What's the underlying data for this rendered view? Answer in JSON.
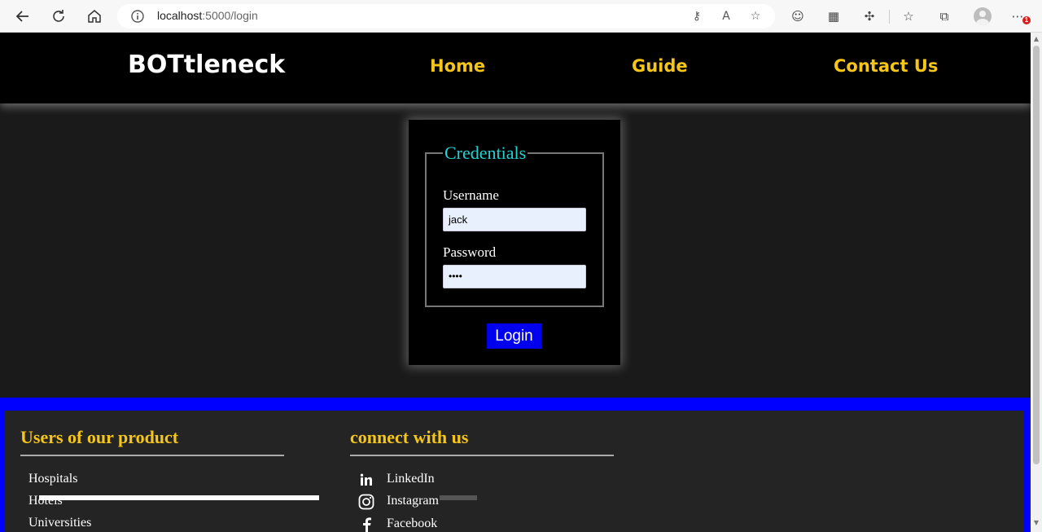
{
  "browser": {
    "url_host": "localhost",
    "url_path": ":5000/login",
    "notification_count": "1"
  },
  "header": {
    "brand": "BOTtleneck",
    "nav": [
      "Home",
      "Guide",
      "Contact Us"
    ]
  },
  "login": {
    "legend": "Credentials",
    "username_label": "Username",
    "username_value": "jack",
    "password_label": "Password",
    "password_value": "••••",
    "submit_label": "Login"
  },
  "footer": {
    "users_title": "Users of our product",
    "users": [
      "Hospitals",
      "Hotels",
      "Universities"
    ],
    "connect_title": "connect with us",
    "social": [
      {
        "label": "LinkedIn",
        "icon": "linkedin-icon"
      },
      {
        "label": "Instagram",
        "icon": "instagram-icon"
      },
      {
        "label": "Facebook",
        "icon": "facebook-icon"
      }
    ]
  },
  "colors": {
    "accent_yellow": "#f5c518",
    "legend_cyan": "#1fd3d3",
    "button_blue": "#0000ee",
    "footer_blue": "#0000ff"
  }
}
